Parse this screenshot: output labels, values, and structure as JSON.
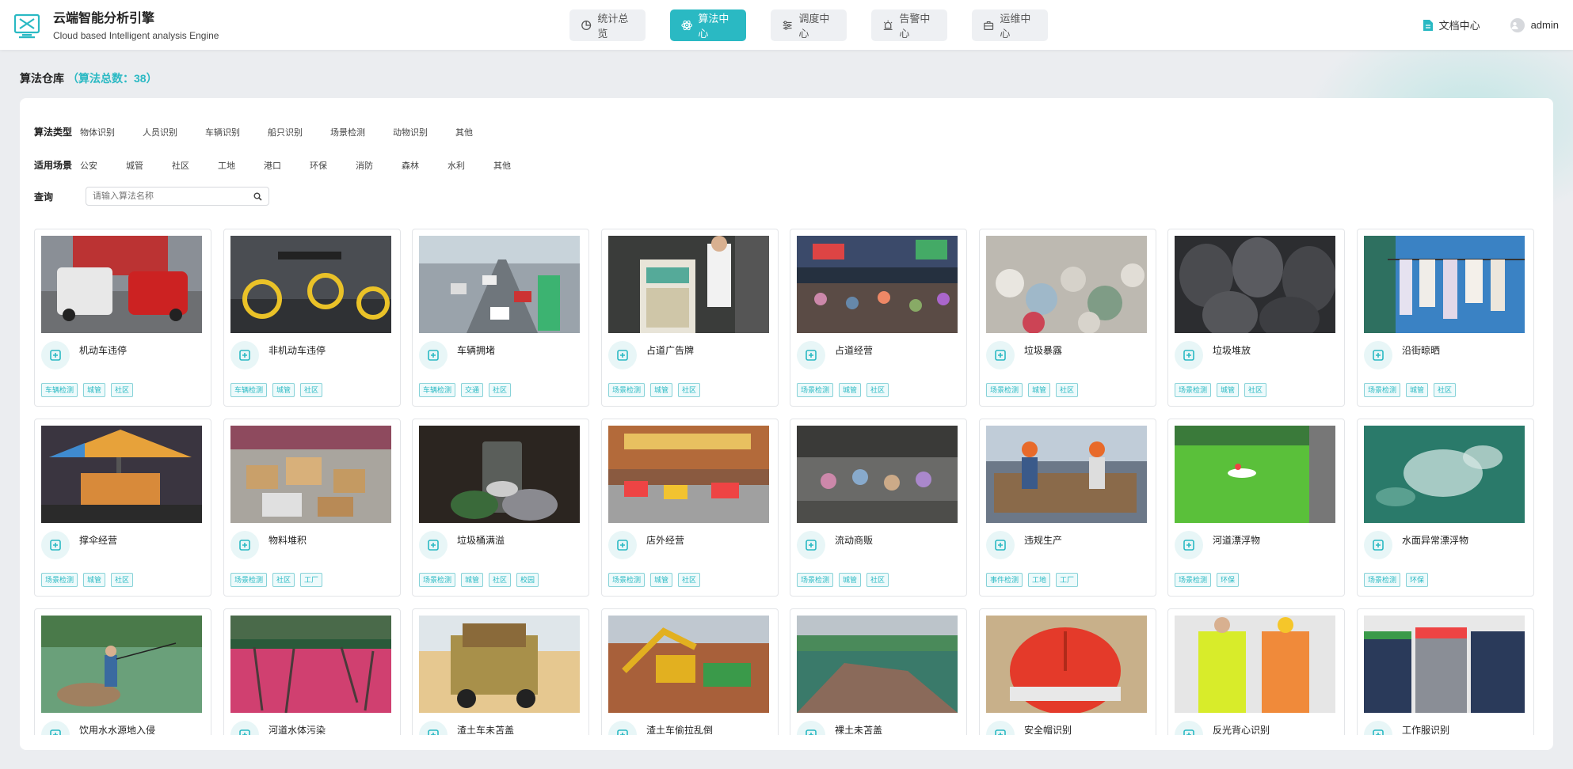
{
  "brand": {
    "title": "云端智能分析引擎",
    "subtitle": "Cloud based Intelligent analysis Engine"
  },
  "nav": [
    {
      "label": "统计总览",
      "icon": "pie-chart-icon",
      "active": false
    },
    {
      "label": "算法中心",
      "icon": "atom-icon",
      "active": true
    },
    {
      "label": "调度中心",
      "icon": "sliders-icon",
      "active": false
    },
    {
      "label": "告警中心",
      "icon": "alarm-icon",
      "active": false
    },
    {
      "label": "运维中心",
      "icon": "toolbox-icon",
      "active": false
    }
  ],
  "header_right": {
    "docs_label": "文档中心",
    "user_label": "admin"
  },
  "page": {
    "title": "算法仓库",
    "count_label": "（算法总数：38）"
  },
  "filters": {
    "type_label": "算法类型",
    "types": [
      "物体识别",
      "人员识别",
      "车辆识别",
      "船只识别",
      "场景检测",
      "动物识别",
      "其他"
    ],
    "scene_label": "适用场景",
    "scenes": [
      "公安",
      "城管",
      "社区",
      "工地",
      "港口",
      "环保",
      "消防",
      "森林",
      "水利",
      "其他"
    ],
    "query_label": "查询",
    "query_placeholder": "请输入算法名称"
  },
  "colors": {
    "accent": "#2ab9c3",
    "tag_border": "#86d2d8",
    "tag_bg": "#eefafb"
  },
  "cards": [
    {
      "name": "机动车违停",
      "icon": "parking-icon",
      "tags": [
        "车辆检测",
        "城管",
        "社区"
      ]
    },
    {
      "name": "非机动车违停",
      "icon": "bike-parking-icon",
      "tags": [
        "车辆检测",
        "城管",
        "社区"
      ]
    },
    {
      "name": "车辆拥堵",
      "icon": "traffic-icon",
      "tags": [
        "车辆检测",
        "交通",
        "社区"
      ]
    },
    {
      "name": "占道广告牌",
      "icon": "billboard-icon",
      "tags": [
        "场景检测",
        "城管",
        "社区"
      ]
    },
    {
      "name": "占道经营",
      "icon": "stall-icon",
      "tags": [
        "场景检测",
        "城管",
        "社区"
      ]
    },
    {
      "name": "垃圾暴露",
      "icon": "trash-icon",
      "tags": [
        "场景检测",
        "城管",
        "社区"
      ]
    },
    {
      "name": "垃圾堆放",
      "icon": "garbage-pile-icon",
      "tags": [
        "场景检测",
        "城管",
        "社区"
      ]
    },
    {
      "name": "沿街晾晒",
      "icon": "clothes-hanger-icon",
      "tags": [
        "场景检测",
        "城管",
        "社区"
      ]
    },
    {
      "name": "撑伞经营",
      "icon": "umbrella-icon",
      "tags": [
        "场景检测",
        "城管",
        "社区"
      ]
    },
    {
      "name": "物料堆积",
      "icon": "boxes-icon",
      "tags": [
        "场景检测",
        "社区",
        "工厂"
      ]
    },
    {
      "name": "垃圾桶满溢",
      "icon": "bin-overflow-icon",
      "tags": [
        "场景检测",
        "城管",
        "社区",
        "校园"
      ]
    },
    {
      "name": "店外经营",
      "icon": "shop-icon",
      "tags": [
        "场景检测",
        "城管",
        "社区"
      ]
    },
    {
      "name": "流动商贩",
      "icon": "vendor-cart-icon",
      "tags": [
        "场景检测",
        "城管",
        "社区"
      ]
    },
    {
      "name": "违规生产",
      "icon": "no-production-icon",
      "tags": [
        "事件检测",
        "工地",
        "工厂"
      ]
    },
    {
      "name": "河道漂浮物",
      "icon": "water-wave-icon",
      "tags": [
        "场景检测",
        "环保"
      ]
    },
    {
      "name": "水面异常漂浮物",
      "icon": "water-wave-icon",
      "tags": [
        "场景检测",
        "环保"
      ]
    },
    {
      "name": "饮用水水源地入侵",
      "icon": "water-source-icon",
      "tags": []
    },
    {
      "name": "河道水体污染",
      "icon": "pollution-icon",
      "tags": []
    },
    {
      "name": "渣土车未苫盖",
      "icon": "truck-icon",
      "tags": []
    },
    {
      "name": "渣土车偷拉乱倒",
      "icon": "truck-dump-icon",
      "tags": []
    },
    {
      "name": "裸土未苫盖",
      "icon": "soil-icon",
      "tags": []
    },
    {
      "name": "安全帽识别",
      "icon": "helmet-icon",
      "tags": []
    },
    {
      "name": "反光背心识别",
      "icon": "vest-icon",
      "tags": []
    },
    {
      "name": "工作服识别",
      "icon": "uniform-icon",
      "tags": []
    }
  ]
}
